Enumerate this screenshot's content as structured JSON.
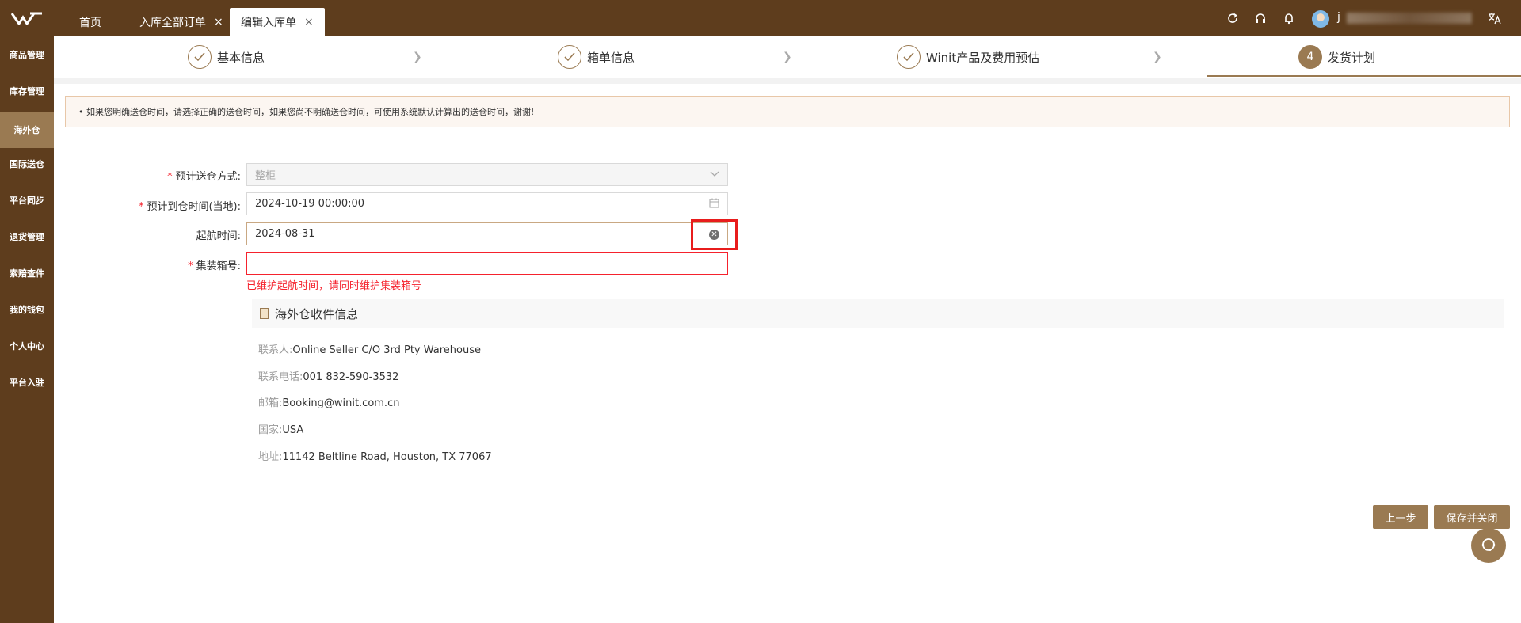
{
  "topbar": {
    "tabs": [
      {
        "label": "首页"
      },
      {
        "label": "入库全部订单",
        "close": "×"
      },
      {
        "label": "编辑入库单",
        "close": "×"
      }
    ],
    "username": "j",
    "icons": [
      "refresh-icon",
      "headset-icon",
      "bell-icon",
      "translate-icon"
    ]
  },
  "sidebar": {
    "items": [
      {
        "label": "商品管理"
      },
      {
        "label": "库存管理"
      },
      {
        "label": "海外仓",
        "active": true
      },
      {
        "label": "国际送仓"
      },
      {
        "label": "平台同步"
      },
      {
        "label": "退货管理"
      },
      {
        "label": "索赔查件"
      },
      {
        "label": "我的钱包"
      },
      {
        "label": "个人中心"
      },
      {
        "label": "平台入驻"
      }
    ]
  },
  "steps": [
    {
      "label": "基本信息",
      "status": "done"
    },
    {
      "label": "箱单信息",
      "status": "done"
    },
    {
      "label": "Winit产品及费用预估",
      "status": "done"
    },
    {
      "label": "发货计划",
      "number": "4",
      "status": "active"
    }
  ],
  "notice": "• 如果您明确送仓时间，请选择正确的送仓时间，如果您尚不明确送仓时间，可使用系统默认计算出的送仓时间，谢谢!",
  "form": {
    "delivery_method": {
      "label": "预计送仓方式:",
      "value": "整柜",
      "required": true
    },
    "arrival_time": {
      "label": "预计到仓时间(当地):",
      "value": "2024-10-19 00:00:00",
      "required": true
    },
    "departure_time": {
      "label": "起航时间:",
      "value": "2024-08-31"
    },
    "container_no": {
      "label": "集装箱号:",
      "value": "",
      "required": true
    },
    "error": "已维护起航时间，请同时维护集装箱号"
  },
  "warehouse": {
    "title": "海外仓收件信息",
    "contact": {
      "label": "联系人:",
      "value": "Online Seller C/O 3rd Pty Warehouse"
    },
    "phone": {
      "label": "联系电话:",
      "value": "001 832-590-3532"
    },
    "email": {
      "label": "邮箱:",
      "value": "Booking@winit.com.cn"
    },
    "country": {
      "label": "国家:",
      "value": "USA"
    },
    "address": {
      "label": "地址:",
      "value": "11142 Beltline Road, Houston, TX 77067"
    }
  },
  "buttons": {
    "prev": "上一步",
    "save_close": "保存并关闭"
  },
  "colors": {
    "brand": "#5e3d1d",
    "accent": "#9a7a52",
    "error": "#f5222d"
  }
}
